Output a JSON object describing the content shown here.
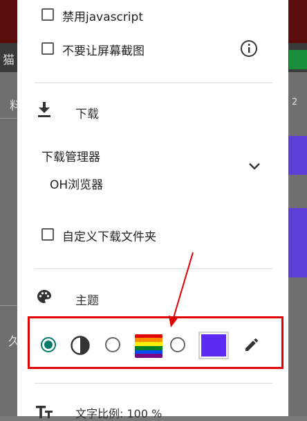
{
  "background": {
    "title_fragment": "猫",
    "tab_fragment": "料",
    "side_fragment": "2",
    "bottom_fragment": "久"
  },
  "settings": {
    "disable_javascript": {
      "label": "禁用javascript",
      "checked": false
    },
    "no_screenshot": {
      "label": "不要让屏幕截图",
      "checked": false,
      "info_icon": "info-icon"
    },
    "download": {
      "title": "下载",
      "icon": "download-icon",
      "manager_label": "下载管理器",
      "manager_value": "OH浏览器",
      "custom_folder": {
        "label": "自定义下载文件夹",
        "checked": false
      }
    },
    "theme": {
      "title": "主题",
      "icon": "palette-icon",
      "options": [
        {
          "name": "default",
          "icon": "radio-selected",
          "selected": true
        },
        {
          "name": "contrast",
          "icon": "contrast-icon",
          "selected": false
        },
        {
          "name": "rainbow",
          "icon": "rainbow-flag-icon",
          "selected": false
        },
        {
          "name": "custom-color",
          "swatch_color": "#5b2bf5",
          "selected": false
        }
      ],
      "edit_icon": "pencil-icon"
    },
    "text_scale": {
      "label": "文字比例: 100 %",
      "icon": "text-size-icon"
    }
  },
  "colors": {
    "accent": "#00796b",
    "highlight": "#e00000",
    "custom_swatch": "#5b2bf5"
  }
}
